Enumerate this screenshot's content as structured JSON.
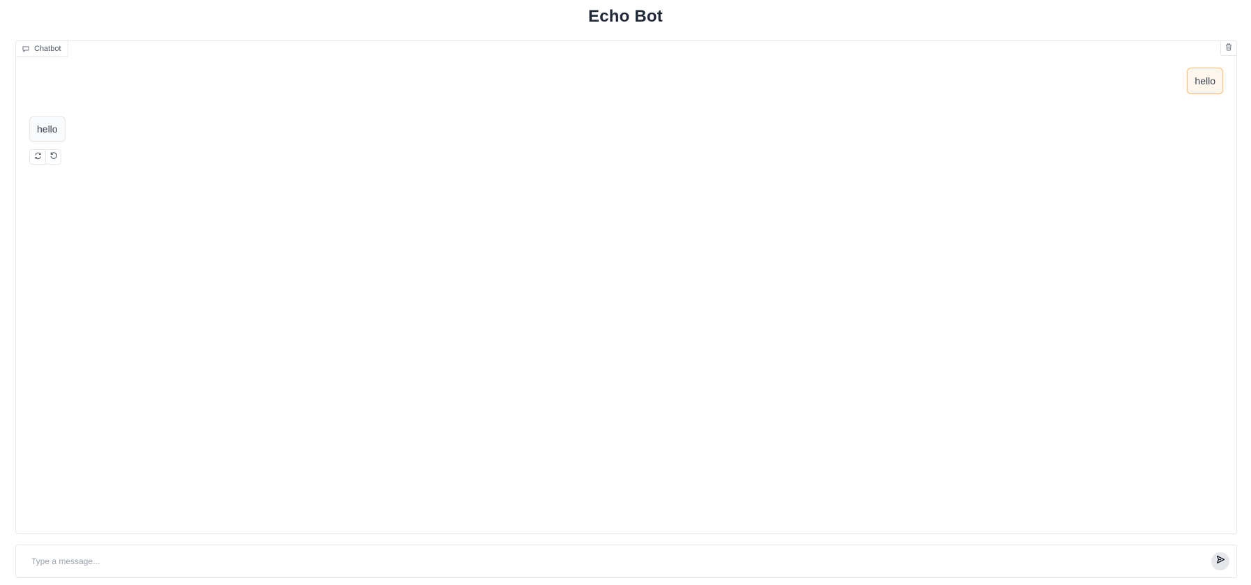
{
  "page": {
    "title": "Echo Bot"
  },
  "chatbot": {
    "label": "Chatbot",
    "label_icon": "chat-icon",
    "clear_icon": "trash-icon",
    "messages": [
      {
        "role": "user",
        "text": "hello"
      },
      {
        "role": "bot",
        "text": "hello"
      }
    ],
    "actions": [
      {
        "name": "retry",
        "icon": "retry-icon"
      },
      {
        "name": "undo",
        "icon": "undo-icon"
      }
    ]
  },
  "input": {
    "placeholder": "Type a message...",
    "value": "",
    "send_icon": "send-icon"
  },
  "colors": {
    "user_bubble_bg": "#fff7ed",
    "user_bubble_border": "#fdba74",
    "bot_bubble_bg": "#f9fafb"
  }
}
